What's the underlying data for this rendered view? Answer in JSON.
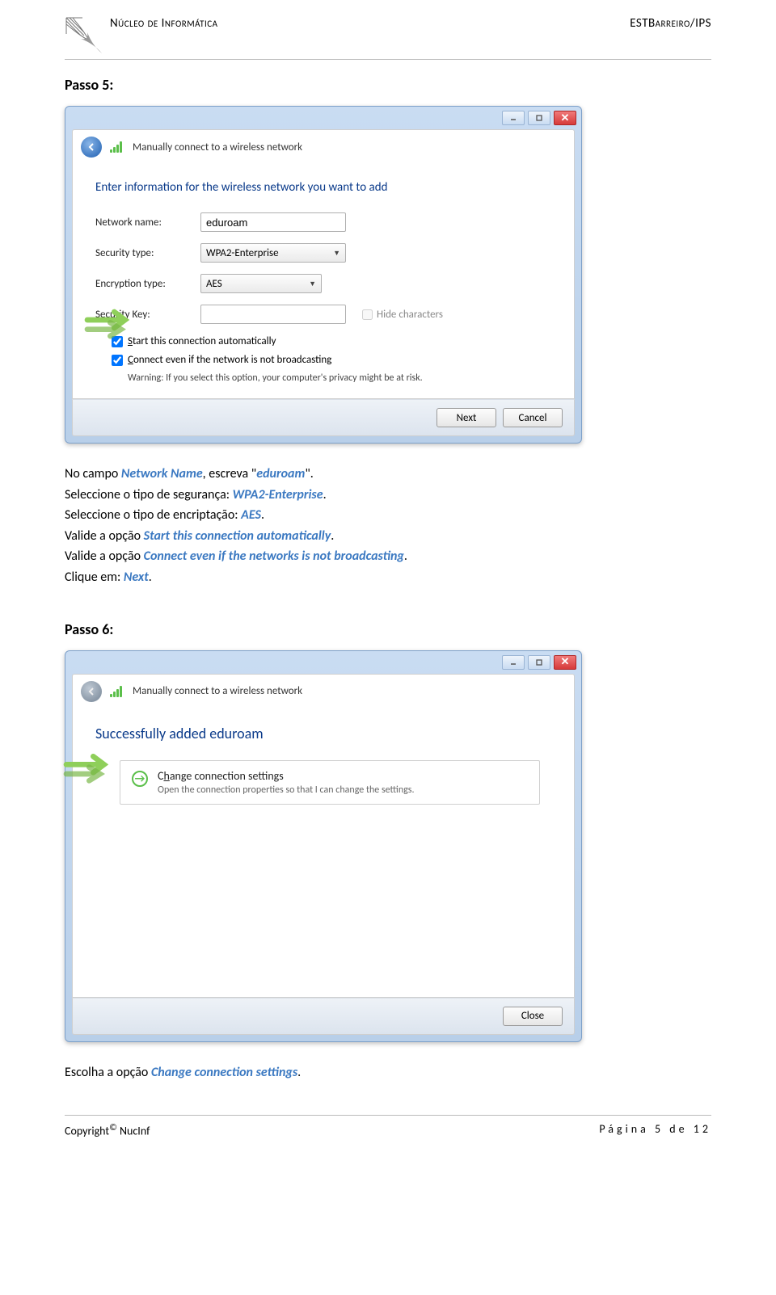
{
  "header": {
    "left": "Núcleo de Informática",
    "right": "ESTBarreiro/IPS"
  },
  "step5": {
    "title": "Passo 5:"
  },
  "dlg1": {
    "crumb": "Manually connect to a wireless network",
    "heading": "Enter information for the wireless network you want to add",
    "lbl_network": "Network name:",
    "val_network": "eduroam",
    "lbl_security": "Security type:",
    "val_security": "WPA2-Enterprise",
    "lbl_encryption": "Encryption type:",
    "val_encryption": "AES",
    "lbl_key": "Security Key:",
    "hide_lbl_pre": "H",
    "hide_lbl_post": "ide characters",
    "chk_start_pre": "S",
    "chk_start_post": "tart this connection automatically",
    "chk_connect_pre": "C",
    "chk_connect_post": "onnect even if the network is not broadcasting",
    "warning": "Warning: If you select this option, your computer's privacy might be at risk.",
    "btn_next": "Next",
    "btn_cancel": "Cancel"
  },
  "instr1": {
    "l1a": "No campo ",
    "l1kw": "Network Name",
    "l1b": ", escreva \"",
    "l1kw2": "eduroam",
    "l1c": "\".",
    "l2a": "Seleccione o tipo de segurança: ",
    "l2kw": "WPA2-Enterprise",
    "l2b": ".",
    "l3a": "Seleccione o tipo de encriptação: ",
    "l3kw": "AES",
    "l3b": ".",
    "l4a": "Valide a opção ",
    "l4kw": "Start this connection automatically",
    "l4b": ".",
    "l5a": "Valide a opção ",
    "l5kw": "Connect even if the networks is not broadcasting",
    "l5b": ".",
    "l6a": "Clique em: ",
    "l6kw": "Next",
    "l6b": "."
  },
  "step6": {
    "title": "Passo 6:"
  },
  "dlg2": {
    "crumb": "Manually connect to a wireless network",
    "heading": "Successfully added eduroam",
    "opt_title_pre": "C",
    "opt_title_mid": "h",
    "opt_title_post": "ange connection settings",
    "opt_sub": "Open the connection properties so that I can change the settings.",
    "btn_close": "Close"
  },
  "instr2": {
    "a": "Escolha a opção ",
    "kw": "Change connection settings",
    "b": "."
  },
  "footer": {
    "copyright": "Copyright",
    "sym": "©",
    "owner": " NucInf",
    "page_word": "Página ",
    "page_num": "5",
    "page_of": " de ",
    "page_total": "12"
  }
}
